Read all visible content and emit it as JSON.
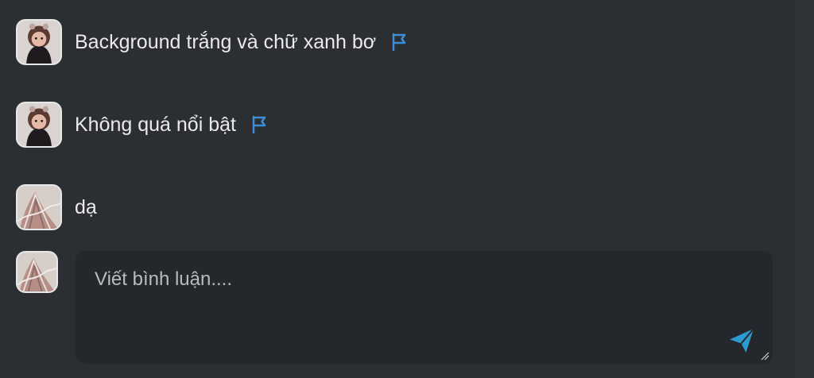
{
  "comments": [
    {
      "text": "Background trắng và chữ xanh bơ",
      "avatar_icon": "avatar-girl-icon",
      "flag_icon": "flag-icon"
    },
    {
      "text": "Không quá nổi bật",
      "avatar_icon": "avatar-girl-icon",
      "flag_icon": "flag-icon"
    },
    {
      "text": "dạ",
      "avatar_icon": "avatar-fabric-icon"
    }
  ],
  "composer": {
    "placeholder": "Viết bình luận....",
    "avatar_icon": "avatar-fabric-icon",
    "send_icon": "send-icon",
    "resize_icon": "resize-handle-icon"
  },
  "colors": {
    "background": "#2b2f33",
    "composer_background": "#24282c",
    "accent_blue": "#3b8fd6",
    "send_blue": "#2e9bd0",
    "text": "#e8eaeb"
  }
}
